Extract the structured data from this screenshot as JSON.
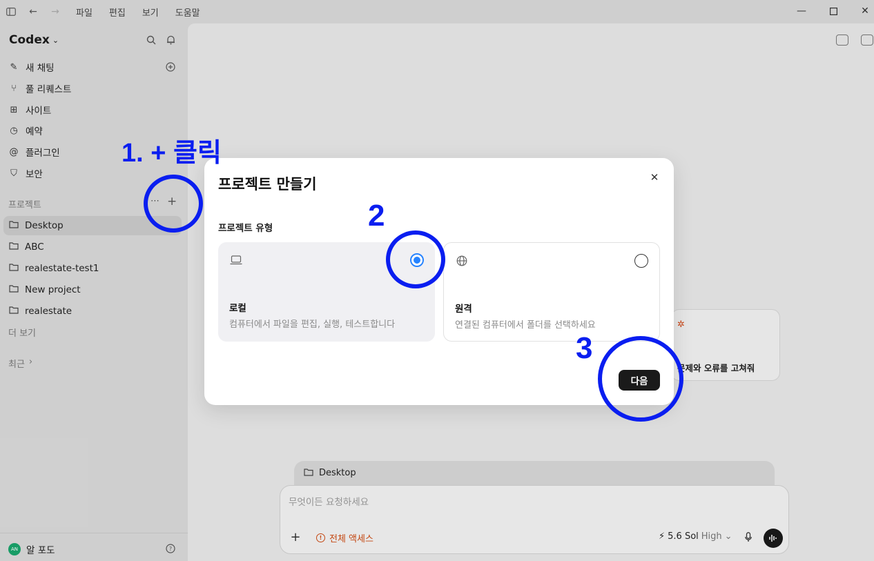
{
  "titlebar": {
    "menus": [
      "파일",
      "편집",
      "보기",
      "도움말"
    ]
  },
  "sidebar": {
    "brand": "Codex",
    "nav": [
      {
        "label": "새 채팅",
        "icon": "edit-icon"
      },
      {
        "label": "풀 리퀘스트",
        "icon": "pull-request-icon"
      },
      {
        "label": "사이트",
        "icon": "sites-icon"
      },
      {
        "label": "예약",
        "icon": "clock-icon"
      },
      {
        "label": "플러그인",
        "icon": "at-icon"
      },
      {
        "label": "보안",
        "icon": "shield-icon"
      }
    ],
    "projects_label": "프로젝트",
    "projects": [
      "Desktop",
      "ABC",
      "realestate-test1",
      "New project",
      "realestate"
    ],
    "more": "더 보기",
    "recent": "최근",
    "user": {
      "initials": "AN",
      "name": "알 포도"
    }
  },
  "main": {
    "suggestion": "문제와 오류를 고쳐줘",
    "context_folder": "Desktop",
    "composer": {
      "placeholder": "무엇이든 요청하세요",
      "access": "전체 액세스",
      "model": "5.6 Sol",
      "level": "High"
    }
  },
  "modal": {
    "title": "프로젝트 만들기",
    "type_label": "프로젝트 유형",
    "options": [
      {
        "name": "로컬",
        "desc": "컴퓨터에서 파일을 편집, 실행, 테스트합니다",
        "selected": true
      },
      {
        "name": "원격",
        "desc": "연결된 컴퓨터에서 폴더를 선택하세요",
        "selected": false
      }
    ],
    "next": "다음"
  },
  "annotations": {
    "step1": "1. + 클릭",
    "step2": "2",
    "step3": "3",
    "color": "#0a1ef0"
  }
}
